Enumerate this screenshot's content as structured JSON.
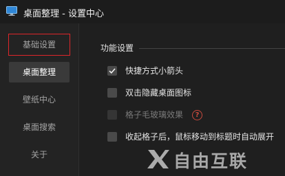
{
  "window": {
    "title": "桌面整理 - 设置中心"
  },
  "sidebar": {
    "items": [
      {
        "label": "基础设置"
      },
      {
        "label": "桌面整理"
      },
      {
        "label": "壁纸中心"
      },
      {
        "label": "桌面搜索"
      },
      {
        "label": "关于"
      }
    ],
    "active_index": 1,
    "highlighted_index": 0
  },
  "main": {
    "section_title": "功能设置",
    "options": [
      {
        "label": "快捷方式小箭头",
        "checked": true,
        "disabled": false
      },
      {
        "label": "双击隐藏桌面图标",
        "checked": false,
        "disabled": false
      },
      {
        "label": "格子毛玻璃效果",
        "checked": false,
        "disabled": true,
        "help_icon": "question-circle-icon",
        "help_glyph": "?"
      },
      {
        "label": "收起格子后，鼠标移动到标题时自动展开",
        "checked": false,
        "disabled": false
      }
    ]
  },
  "watermark": {
    "text": "自由互联"
  },
  "colors": {
    "highlight_border": "#e0262a",
    "help_icon": "#c94a3e",
    "background": "#1f1f1f"
  }
}
